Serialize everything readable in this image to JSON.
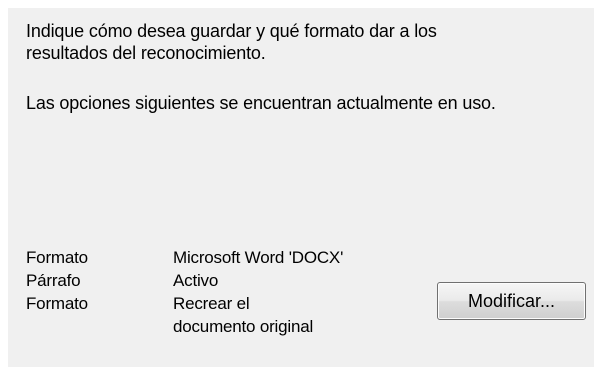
{
  "intro": {
    "line1": "Indique cómo desea guardar y qué formato dar a los",
    "line2": "resultados del reconocimiento."
  },
  "status_text": "Las opciones siguientes se encuentran actualmente en uso.",
  "settings": [
    {
      "label": "Formato",
      "value": "Microsoft Word 'DOCX'"
    },
    {
      "label": "Párrafo",
      "value": "Activo"
    },
    {
      "label": "Formato",
      "value_line1": "Recrear el",
      "value_line2": "documento original"
    }
  ],
  "modify_button": {
    "label": "Modificar..."
  }
}
